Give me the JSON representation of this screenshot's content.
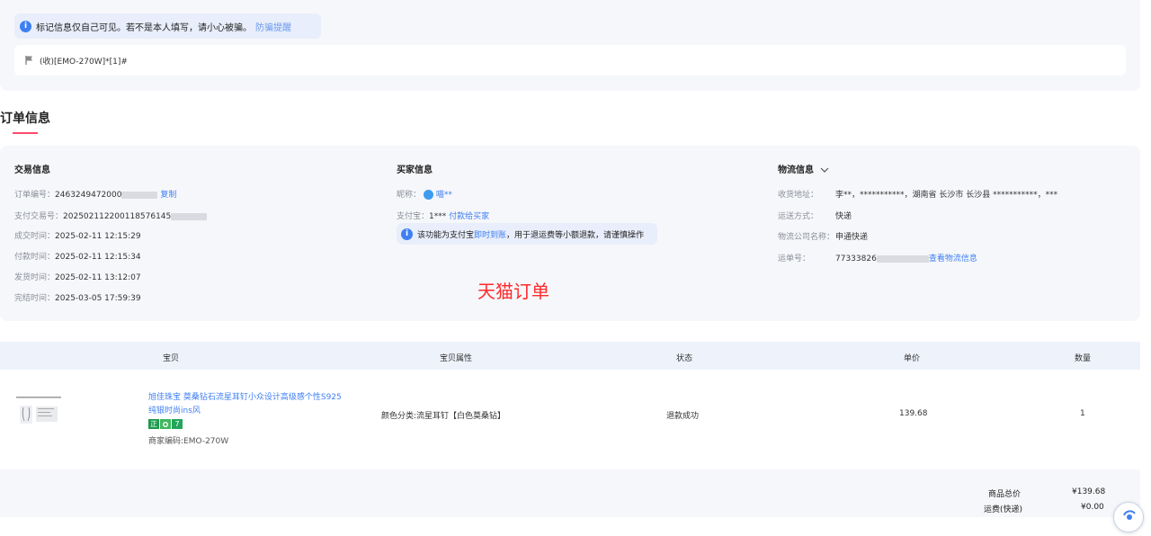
{
  "notice": {
    "text": "标记信息仅自己可见。若不是本人填写，请小心被骗。",
    "link": "防骗提醒"
  },
  "memo": {
    "text": "(收)[EMO-270W]*[1]#"
  },
  "section_title": "订单信息",
  "trade": {
    "title": "交易信息",
    "order_no_label": "订单编号：",
    "order_no_value": "2463249472000",
    "copy_label": "复制",
    "pay_no_label": "支付交易号：",
    "pay_no_value": "202502112200118576145",
    "deal_time_label": "成交时间：",
    "deal_time_value": "2025-02-11 12:15:29",
    "pay_time_label": "付款时间：",
    "pay_time_value": "2025-02-11 12:15:34",
    "ship_time_label": "发货时间：",
    "ship_time_value": "2025-02-11 13:12:07",
    "finish_time_label": "完结时间：",
    "finish_time_value": "2025-03-05 17:59:39"
  },
  "buyer": {
    "title": "买家信息",
    "nick_label": "昵称：",
    "nick_value": "喵**",
    "alipay_label": "支付宝：",
    "alipay_value": "1***",
    "pay_buyer_link": "付款给买家",
    "tip_prefix": "该功能为支付宝",
    "tip_link": "即时到账",
    "tip_suffix": "，用于退运费等小额退款，请谨慎操作"
  },
  "tmall_label": "天猫订单",
  "logistics": {
    "title": "物流信息",
    "address_label": "收货地址：",
    "address_value": "李**，***********，湖南省 长沙市 长沙县 ***********，***",
    "ship_method_label": "运送方式：",
    "ship_method_value": "快递",
    "company_label": "物流公司名称：",
    "company_value": "申通快递",
    "tracking_label": "运单号：",
    "tracking_value": "77333826",
    "tracking_link": "查看物流信息"
  },
  "table": {
    "headers": [
      "宝贝",
      "宝贝属性",
      "状态",
      "单价",
      "数量"
    ],
    "item": {
      "title": "旭佳珠宝 莫桑钻石流星耳钉小众设计高级感个性S925纯银时尚ins风",
      "tags": [
        "正",
        "",
        "7"
      ],
      "merchant_code": "商家编码:EMO-270W",
      "attr": "颜色分类:流星耳钉【白色莫桑钻】",
      "status": "退款成功",
      "price": "139.68",
      "qty": "1"
    }
  },
  "summary": {
    "total_label": "商品总价",
    "total_value": "¥139.68",
    "freight_label": "运费(快递)",
    "freight_value": "¥0.00"
  },
  "colors": {
    "accent": "#3f7ff3",
    "tmall_red": "#ff2a2a",
    "underline": "#ff4a6b",
    "panel_bg": "#f6f7fa"
  },
  "icons": [
    "info-icon",
    "flag-icon",
    "chevron-down-icon",
    "avatar-icon"
  ]
}
